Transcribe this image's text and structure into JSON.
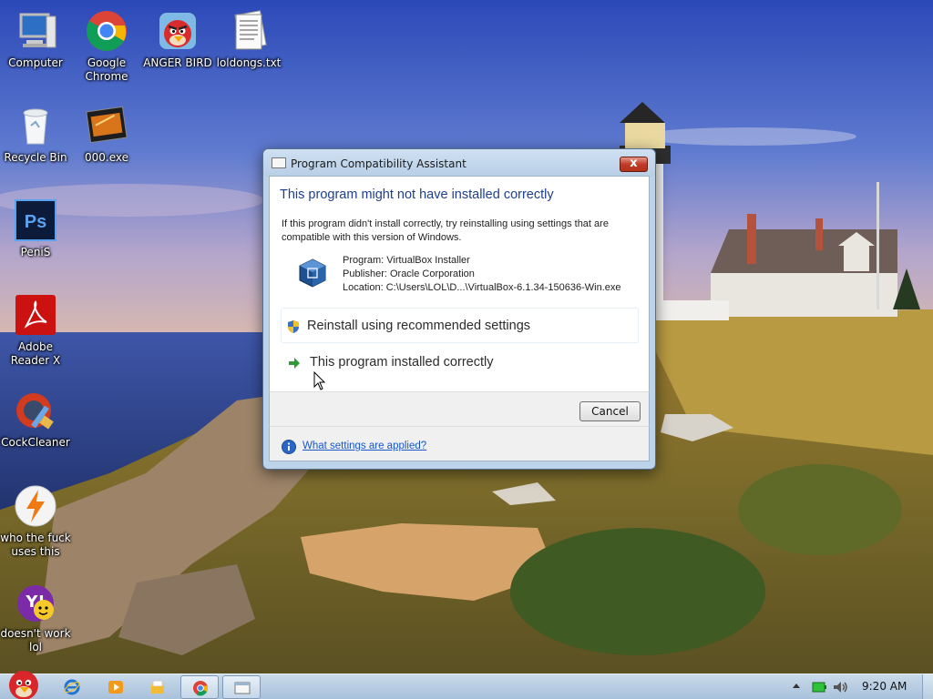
{
  "desktop": {
    "icons": [
      {
        "label": "Computer",
        "icon": "computer-icon"
      },
      {
        "label": "Google Chrome",
        "icon": "chrome-icon"
      },
      {
        "label": "ANGER BIRD",
        "icon": "angry-bird-icon"
      },
      {
        "label": "loldongs.txt",
        "icon": "text-file-icon"
      },
      {
        "label": "Recycle Bin",
        "icon": "recycle-bin-icon"
      },
      {
        "label": "000.exe",
        "icon": "exe-icon"
      },
      {
        "label": "PeniS",
        "icon": "photoshop-icon"
      },
      {
        "label": "Adobe Reader X",
        "icon": "adobe-reader-icon"
      },
      {
        "label": "CockCleaner",
        "icon": "ccleaner-icon"
      },
      {
        "label": "who the fuck uses this",
        "icon": "winamp-icon"
      },
      {
        "label": "doesn't work lol",
        "icon": "yahoo-messenger-icon"
      }
    ]
  },
  "dialog": {
    "title": "Program Compatibility Assistant",
    "close_label": "x",
    "heading": "This program might not have installed correctly",
    "description": "If this program didn't install correctly, try reinstalling using settings that are compatible with this version of Windows.",
    "program_line": "Program: VirtualBox Installer",
    "publisher_line": "Publisher: Oracle Corporation",
    "location_line": "Location: C:\\Users\\LOL\\D...\\VirtualBox-6.1.34-150636-Win.exe",
    "option_reinstall": "Reinstall using recommended settings",
    "option_correct": "This program installed correctly",
    "cancel_label": "Cancel",
    "help_link": "What settings are applied?"
  },
  "taskbar": {
    "pinned": [
      "internet-explorer-icon",
      "media-player-icon",
      "explorer-folder-icon",
      "chrome-icon",
      "compat-assistant-icon"
    ],
    "clock": "9:20 AM"
  },
  "colors": {
    "heading_blue": "#1e3f8e",
    "link_blue": "#1a56c8",
    "close_red": "#c13b27",
    "taskbar": "#b9cfe3"
  }
}
